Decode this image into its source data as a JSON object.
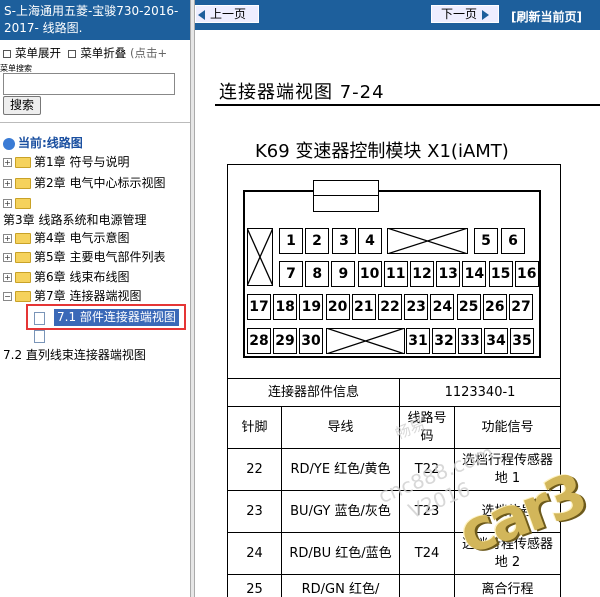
{
  "left_panel": {
    "title": "S-上海通用五菱-宝骏730-2016-2017- 线路图.",
    "menu_expand": "菜单展开",
    "menu_collapse": "菜单折叠",
    "menu_hint": "(点击+",
    "search_label": "菜单搜索",
    "search_button": "搜索",
    "tree": {
      "current": "当前:线路图",
      "items": [
        "第1章 符号与说明",
        "第2章 电气中心标示视图",
        "",
        "第3章 线路系统和电源管理",
        "第4章 电气示意图",
        "第5章 主要电气部件列表",
        "第6章 线束布线图",
        "第7章 连接器端视图",
        "7.1 部件连接器端视图",
        "",
        "7.2 直列线束连接器端视图"
      ]
    }
  },
  "toolbar": {
    "prev": "上一页",
    "next": "下一页",
    "refresh": "[刷新当前页]"
  },
  "content": {
    "heading": "连接器端视图 7-24",
    "connector_title": "K69 变速器控制模块 X1(iAMT)",
    "pins": {
      "row1": [
        "1",
        "2",
        "3",
        "4",
        "5",
        "6"
      ],
      "row2": [
        "7",
        "8",
        "9",
        "10",
        "11",
        "12",
        "13",
        "14",
        "15",
        "16"
      ],
      "row3": [
        "17",
        "18",
        "19",
        "20",
        "21",
        "22",
        "23",
        "24",
        "25",
        "26",
        "27"
      ],
      "row4": [
        "28",
        "29",
        "30",
        "31",
        "32",
        "33",
        "34",
        "35"
      ]
    },
    "info": {
      "label": "连接器部件信息",
      "part_number": "1123340-1",
      "col_pin": "针脚",
      "col_wire": "导线",
      "col_circuit": "线路号码",
      "col_function": "功能信号",
      "rows": [
        {
          "pin": "22",
          "wire": "RD/YE 红色/黄色",
          "circuit": "T22",
          "function": "选档行程传感器地 1"
        },
        {
          "pin": "23",
          "wire": "BU/GY 蓝色/灰色",
          "circuit": "T23",
          "function": "选档信号"
        },
        {
          "pin": "24",
          "wire": "RD/BU 红色/蓝色",
          "circuit": "T24",
          "function": "选档行程传感器地 2"
        },
        {
          "pin": "25",
          "wire": "RD/GN 红色/",
          "circuit": "",
          "function": "离合行程"
        }
      ]
    },
    "watermark": {
      "line1": "畅易",
      "line2": "cnc888.com",
      "line3": "V2016"
    },
    "logo": "car3"
  }
}
